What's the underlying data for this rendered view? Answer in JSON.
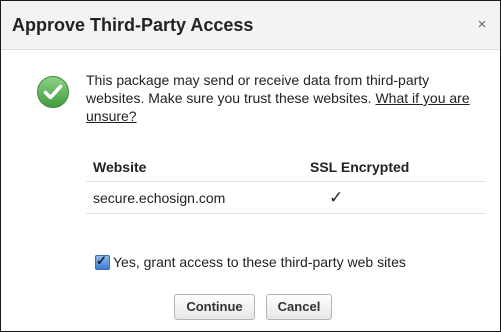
{
  "dialog": {
    "title": "Approve Third-Party Access",
    "close_label": "×",
    "message_text": "This package may send or receive data from third-party websites. Make sure you trust these websites. ",
    "message_link": "What if you are unsure?",
    "check_icon": "check-circle-icon",
    "accent_green": "#5fb85a"
  },
  "table": {
    "headers": [
      "Website",
      "SSL Encrypted"
    ],
    "rows": [
      {
        "website": "secure.echosign.com",
        "ssl": "✓"
      }
    ]
  },
  "grant": {
    "checked": true,
    "label": "Yes, grant access to these third-party web sites"
  },
  "buttons": {
    "continue_label": "Continue",
    "cancel_label": "Cancel"
  }
}
